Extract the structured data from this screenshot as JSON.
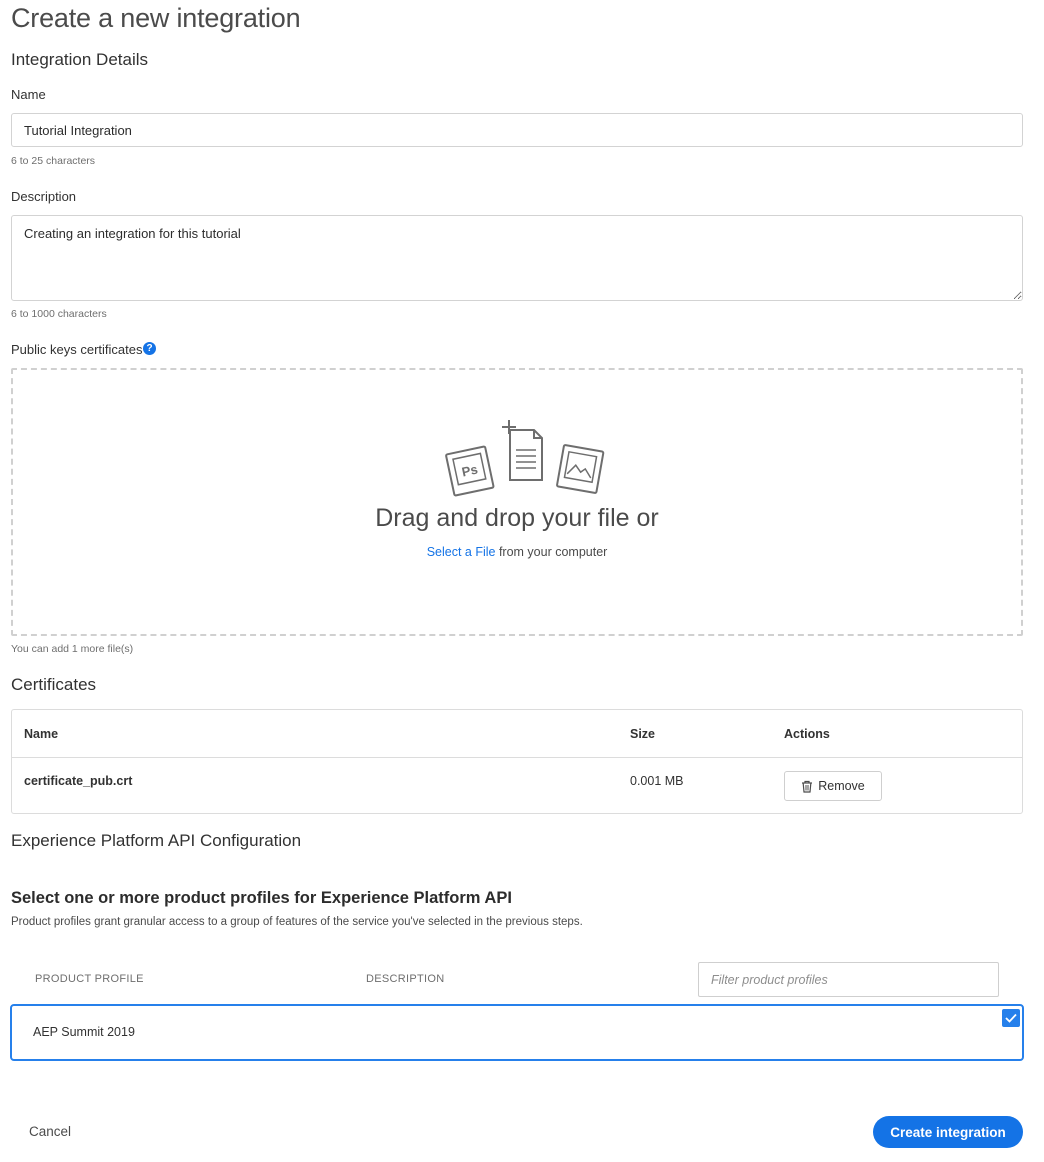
{
  "page": {
    "title": "Create a new integration"
  },
  "details": {
    "section_title": "Integration Details",
    "name_label": "Name",
    "name_value": "Tutorial Integration",
    "name_hint": "6 to 25 characters",
    "description_label": "Description",
    "description_value": "Creating an integration for this tutorial",
    "description_hint": "6 to 1000 characters",
    "keys_label": "Public keys certificates",
    "help_glyph": "?"
  },
  "dropzone": {
    "title": "Drag and drop your file or",
    "select_link": "Select a File",
    "select_suffix": " from your computer",
    "file_hint": "You can add 1 more file(s)",
    "art_ps_label": "Ps",
    "icons": [
      "photoshop-file-icon",
      "document-add-icon",
      "image-file-icon"
    ]
  },
  "certificates": {
    "section_title": "Certificates",
    "columns": [
      "Name",
      "Size",
      "Actions"
    ],
    "rows": [
      {
        "name": "certificate_pub.crt",
        "size": "0.001 MB",
        "action_label": "Remove"
      }
    ]
  },
  "api_config": {
    "section_title": "Experience Platform API Configuration",
    "profiles_title": "Select one or more product profiles for Experience Platform API",
    "profiles_subtitle": "Product profiles grant granular access to a group of features of the service you've selected in the previous steps.",
    "columns": [
      "PRODUCT PROFILE",
      "DESCRIPTION"
    ],
    "filter_placeholder": "Filter product profiles",
    "profiles": [
      {
        "name": "AEP Summit 2019",
        "description": "",
        "checked": true
      }
    ]
  },
  "footer": {
    "cancel_label": "Cancel",
    "submit_label": "Create integration"
  },
  "colors": {
    "accent": "#1473e6",
    "selected_border": "#2680eb",
    "border": "#d3d3d3"
  }
}
